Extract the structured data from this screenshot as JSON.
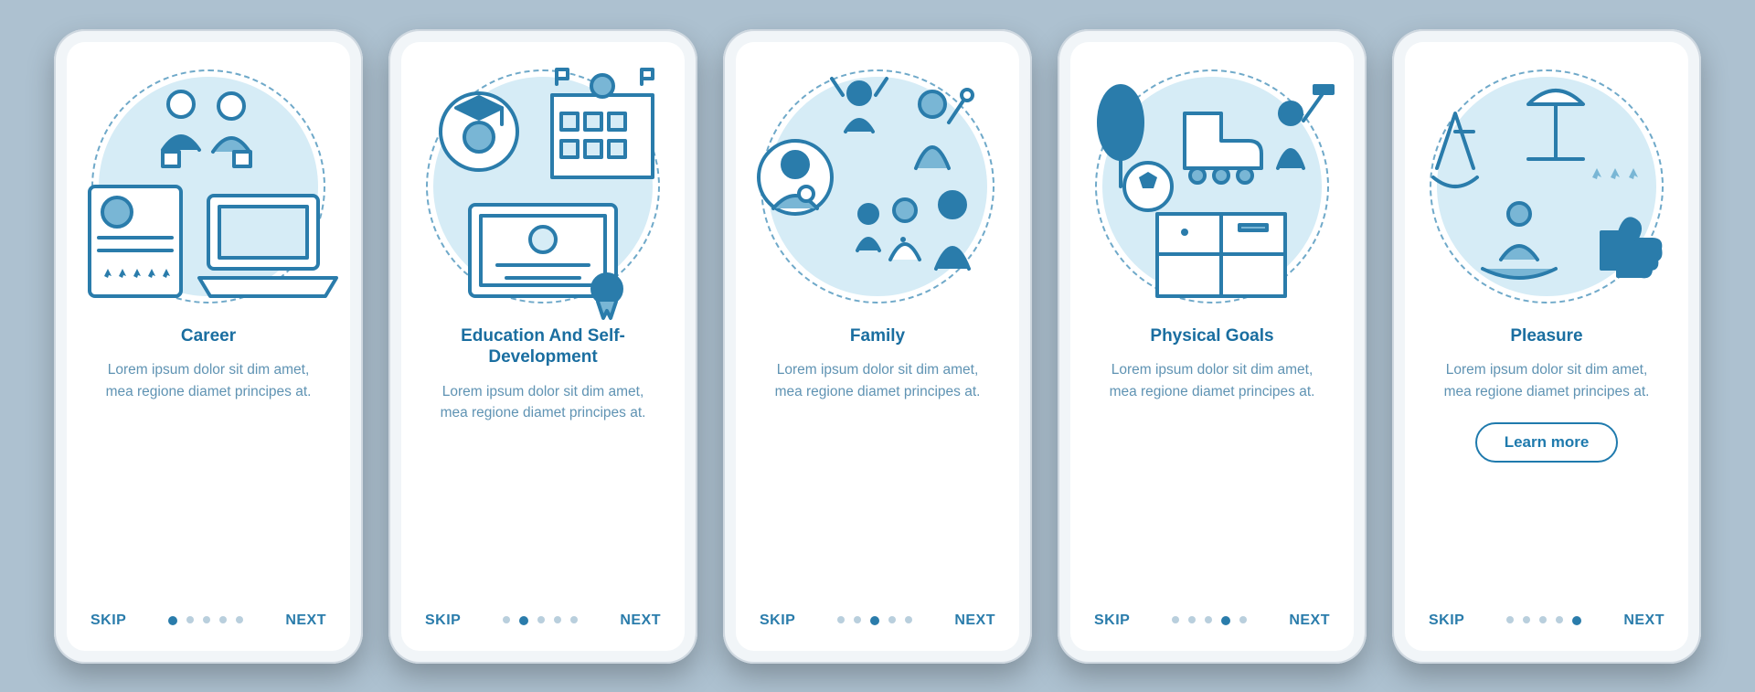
{
  "common": {
    "skip": "SKIP",
    "next": "NEXT",
    "learn_more": "Learn more",
    "lorem": "Lorem ipsum dolor sit dim amet, mea regione diamet principes at."
  },
  "screens": [
    {
      "title": "Career",
      "active_index": 0,
      "has_cta": false,
      "icon": "career"
    },
    {
      "title": "Education And Self-Development",
      "active_index": 1,
      "has_cta": false,
      "icon": "education"
    },
    {
      "title": "Family",
      "active_index": 2,
      "has_cta": false,
      "icon": "family"
    },
    {
      "title": "Physical Goals",
      "active_index": 3,
      "has_cta": false,
      "icon": "physical"
    },
    {
      "title": "Pleasure",
      "active_index": 4,
      "has_cta": true,
      "icon": "pleasure"
    }
  ],
  "colors": {
    "bg": "#adc1d0",
    "accent": "#1f7aad",
    "light": "#d6ecf6",
    "stroke": "#2a7cab"
  }
}
